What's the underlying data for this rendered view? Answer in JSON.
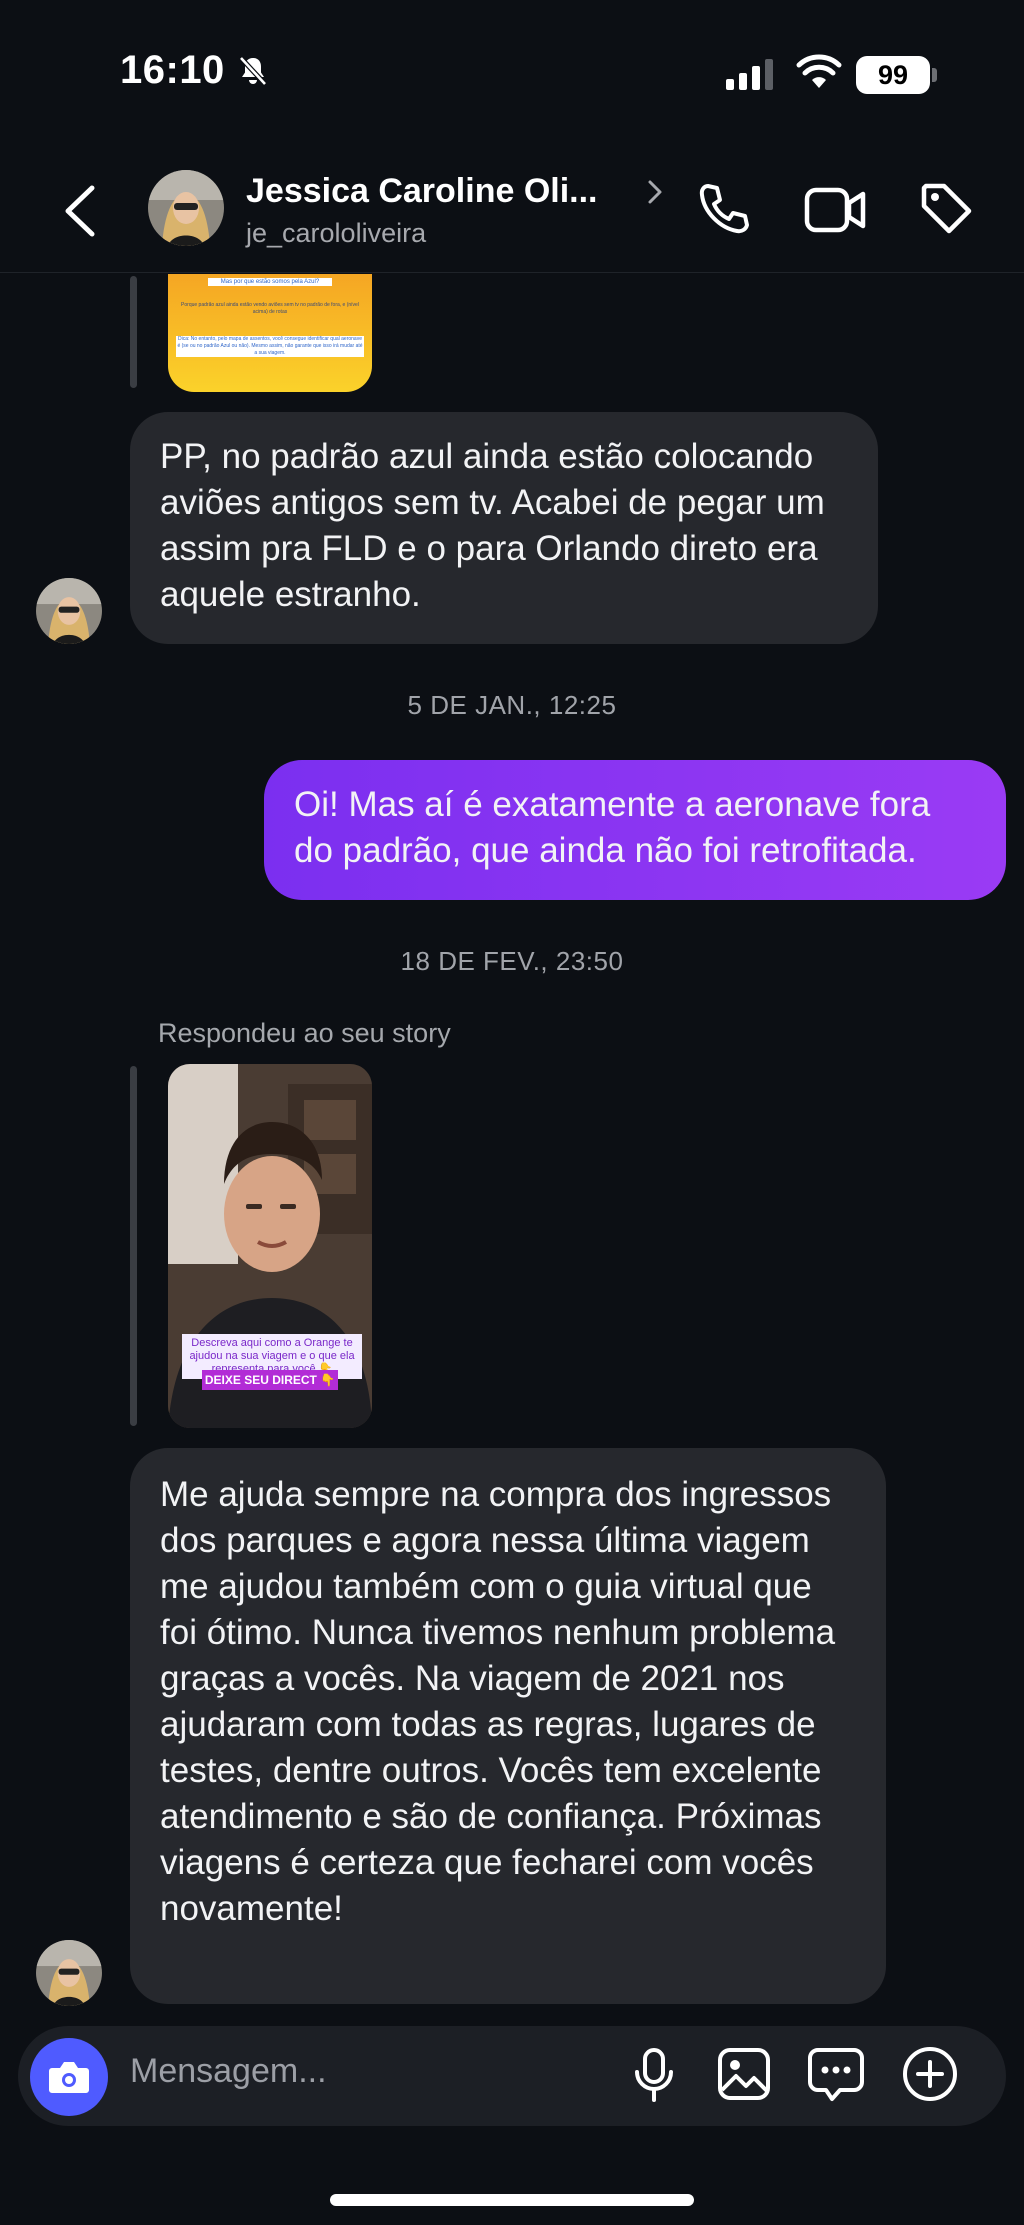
{
  "status_bar": {
    "time": "16:10",
    "battery": "99"
  },
  "header": {
    "name": "Jessica Caroline Oli...",
    "handle": "je_carololiveira"
  },
  "top_story": {
    "line1": "Mas por que estão somos pela Azul?",
    "line2": "Porque padrão azul ainda estão vendo aviões sem tv no padrão de fora, e (nível acima) de rotas",
    "line3": "Dica: No entanto, pelo mapa de assentos, você consegue identificar qual aeronave é (se ou no padrão Azul ou não). Mesmo assim, não garante que isso irá mudar até a sua viagem."
  },
  "messages": [
    {
      "id": "m1",
      "direction": "in",
      "text": "PP, no padrão azul ainda estão colocando aviões antigos sem tv. Acabei de pegar um assim pra FLD e o para Orlando direto era aquele estranho."
    },
    {
      "id": "m2",
      "direction": "out",
      "text": "Oi! Mas aí é exatamente a aeronave fora do padrão, que ainda não foi retrofitada."
    },
    {
      "id": "m3",
      "direction": "in",
      "text": "Me ajuda sempre na compra dos ingressos dos parques e agora nessa última viagem me ajudou também com o guia virtual que foi ótimo. Nunca tivemos nenhum problema graças a vocês. Na viagem de 2021 nos ajudaram com todas as regras, lugares de testes, dentre outros. Vocês tem excelente atendimento e são de confiança. Próximas viagens é certeza que fecharei com vocês novamente!"
    }
  ],
  "timestamps": [
    "5 DE JAN., 12:25",
    "18 DE FEV., 23:50"
  ],
  "replied_label": "Respondeu ao seu story",
  "story2": {
    "caption": "Descreva aqui como a Orange te ajudou na sua viagem e o que ela representa para você 👇",
    "cta": "DEIXE SEU DIRECT 👇"
  },
  "composer": {
    "placeholder": "Mensagem..."
  },
  "icons": {
    "back": "chevron-left-icon",
    "phone": "phone-icon",
    "video": "video-icon",
    "tag": "tag-icon",
    "camera": "camera-icon",
    "mic": "microphone-icon",
    "gallery": "image-icon",
    "sticker": "sticker-icon",
    "plus": "plus-icon"
  },
  "colors": {
    "background": "#0c0f14",
    "incoming_bubble": "#26282d",
    "outgoing_bubble": "#8b35f2",
    "camera_button": "#4f5bff"
  }
}
